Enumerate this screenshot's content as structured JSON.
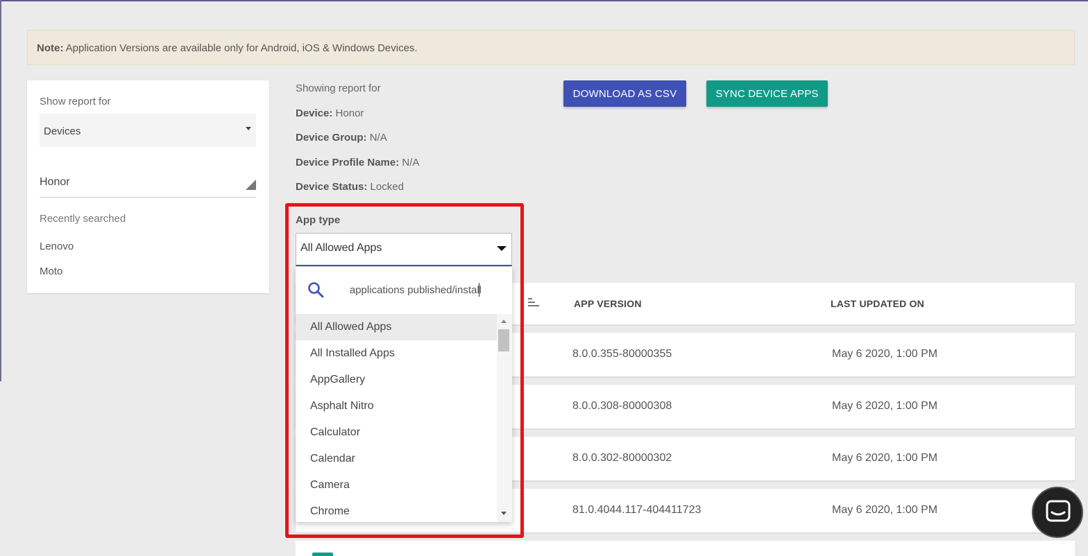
{
  "note": {
    "label": "Note:",
    "text": "Application Versions are available only for Android, iOS & Windows Devices."
  },
  "sidebar": {
    "show_report_label": "Show report for",
    "report_type": "Devices",
    "device_value": "Honor",
    "recent_title": "Recently searched",
    "recent_items": [
      "Lenovo",
      "Moto"
    ]
  },
  "report": {
    "showing_label": "Showing report for",
    "device_label": "Device:",
    "device_value": "Honor",
    "group_label": "Device Group:",
    "group_value": "N/A",
    "profile_label": "Device Profile Name:",
    "profile_value": "N/A",
    "status_label": "Device Status:",
    "status_value": "Locked"
  },
  "buttons": {
    "download_csv": "DOWNLOAD AS CSV",
    "sync_apps": "SYNC DEVICE APPS"
  },
  "app_type": {
    "label": "App type",
    "selected": "All Allowed Apps",
    "search_value": "applications published/install",
    "options": [
      "All Allowed Apps",
      "All Installed Apps",
      "AppGallery",
      "Asphalt Nitro",
      "Calculator",
      "Calendar",
      "Camera",
      "Chrome"
    ]
  },
  "table": {
    "headers": {
      "version": "APP VERSION",
      "updated": "LAST UPDATED ON"
    },
    "rows": [
      {
        "version": "8.0.0.355-80000355",
        "updated": "May 6 2020, 1:00 PM"
      },
      {
        "version": "8.0.0.308-80000308",
        "updated": "May 6 2020, 1:00 PM"
      },
      {
        "version": "8.0.0.302-80000302",
        "updated": "May 6 2020, 1:00 PM"
      },
      {
        "version": "81.0.4044.117-404411723",
        "updated": "May 6 2020, 1:00 PM"
      }
    ]
  },
  "colors": {
    "primary": "#3f51b5",
    "teal": "#119b87",
    "highlight": "#e8141b"
  },
  "icons": {
    "search": "search-icon",
    "chat": "chat-icon",
    "sort": "sort-icon"
  }
}
